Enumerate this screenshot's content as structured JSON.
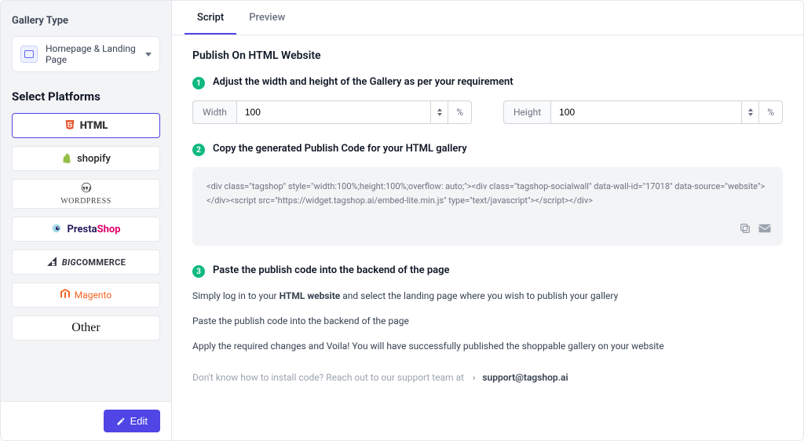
{
  "sidebar": {
    "gallery_type_label": "Gallery Type",
    "gallery_type_value": "Homepage & Landing Page",
    "select_platforms_label": "Select Platforms",
    "platforms": {
      "html": "HTML",
      "shopify": "shopify",
      "wordpress": "WORDPRESS",
      "prestashop_pre": "Presta",
      "prestashop_suf": "Shop",
      "bigcommerce_pre": "BIG",
      "bigcommerce_suf": "COMMERCE",
      "magento": "Magento",
      "other": "Other"
    },
    "edit_label": "Edit"
  },
  "tabs": {
    "script": "Script",
    "preview": "Preview"
  },
  "main": {
    "title": "Publish On HTML Website",
    "step1_text": "Adjust the width and height of the Gallery as per your requirement",
    "step2_text": "Copy the generated Publish Code for your HTML gallery",
    "step3_text": "Paste the publish code into the backend of the page",
    "width_label": "Width",
    "width_value": "100",
    "width_unit": "%",
    "height_label": "Height",
    "height_value": "100",
    "height_unit": "%",
    "code": "<div class=\"tagshop\" style=\"width:100%;height:100%;overflow: auto;\"><div class=\"tagshop-socialwall\" data-wall-id=\"17018\" data-source=\"website\"></div><script src=\"https://widget.tagshop.ai/embed-lite.min.js\" type=\"text/javascript\"></script></div>",
    "instruction_1_pre": "Simply log in to your ",
    "instruction_1_bold": "HTML website",
    "instruction_1_post": " and select the landing page where you wish to publish your gallery",
    "instruction_2": "Paste the publish code into the backend of the page",
    "instruction_3": "Apply the required changes and Voila! You will have successfully published the shoppable gallery on your website",
    "support_pre": "Don't know how to install code? Reach out to our support team at",
    "support_email": "support@tagshop.ai"
  }
}
